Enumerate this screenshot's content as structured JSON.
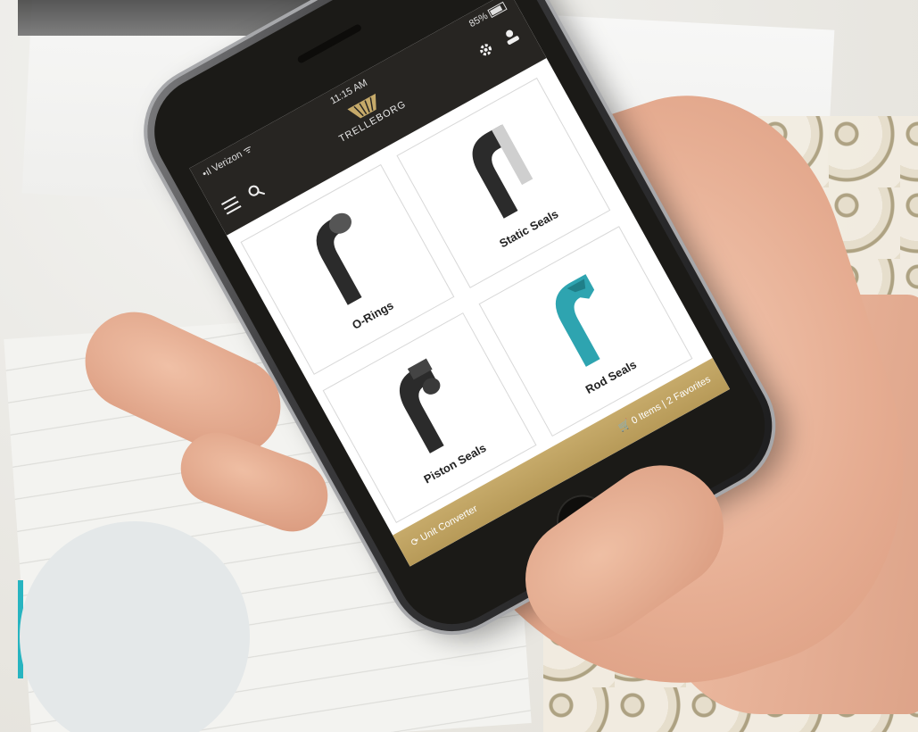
{
  "status_bar": {
    "carrier": "Verizon",
    "time": "11:15 AM",
    "battery": "85%"
  },
  "header": {
    "logo_text": "TRELLEBORG",
    "menu_icon": "hamburger-menu-icon",
    "search_icon": "search-icon",
    "settings_icon": "gear-icon",
    "account_icon": "user-icon"
  },
  "products": [
    {
      "label": "O-Rings",
      "color": "#2b2b2b"
    },
    {
      "label": "Static Seals",
      "color": "#2b2b2b"
    },
    {
      "label": "Piston Seals",
      "color": "#2b2b2b"
    },
    {
      "label": "Rod Seals",
      "color": "#2ea4b0"
    }
  ],
  "footer": {
    "unit_converter": "Unit Converter",
    "cart_summary": "0 Items | 2 Favorites"
  },
  "colors": {
    "header_bg": "#272522",
    "footer_gold": "#bfa262",
    "accent_teal": "#2ea4b0"
  }
}
